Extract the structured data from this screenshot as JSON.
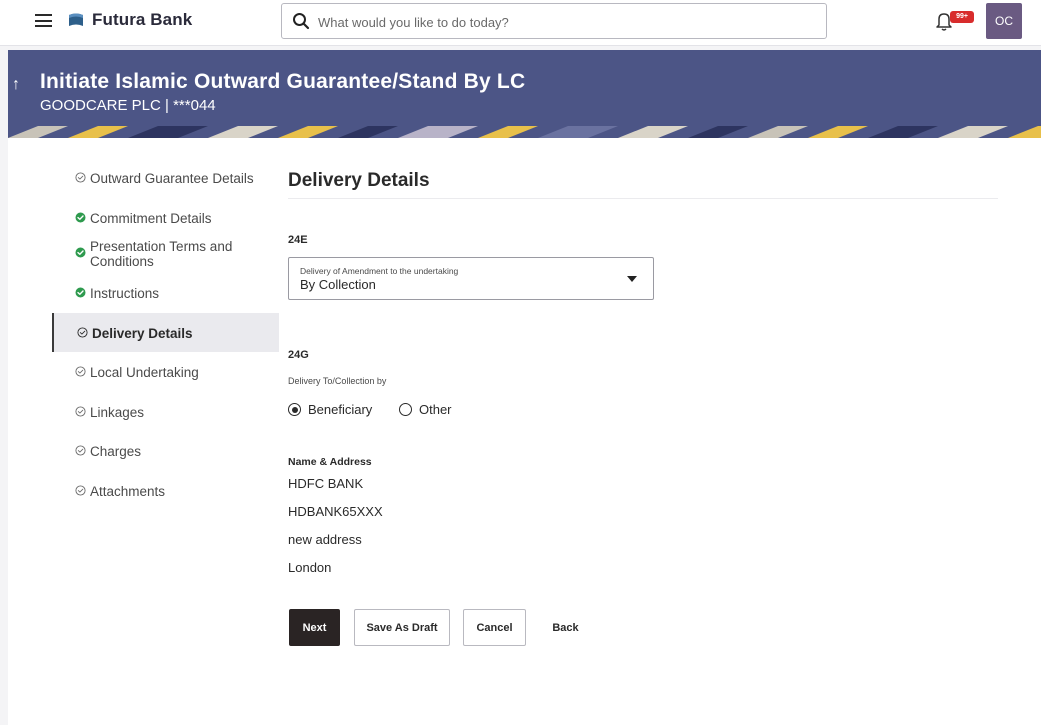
{
  "header": {
    "brand": "Futura Bank",
    "search_placeholder": "What would you like to do today?",
    "notification_badge": "99+",
    "avatar_initials": "OC"
  },
  "banner": {
    "title": "Initiate Islamic Outward Guarantee/Stand By LC",
    "subtitle": "GOODCARE PLC | ***044"
  },
  "steps": [
    {
      "label": "Outward Guarantee Details",
      "status": "pending"
    },
    {
      "label": "Commitment Details",
      "status": "complete"
    },
    {
      "label": "Presentation Terms and Conditions",
      "status": "complete"
    },
    {
      "label": "Instructions",
      "status": "complete"
    },
    {
      "label": "Delivery Details",
      "status": "active"
    },
    {
      "label": "Local Undertaking",
      "status": "pending"
    },
    {
      "label": "Linkages",
      "status": "pending"
    },
    {
      "label": "Charges",
      "status": "pending"
    },
    {
      "label": "Attachments",
      "status": "pending"
    }
  ],
  "form": {
    "heading": "Delivery Details",
    "field_24e_code": "24E",
    "delivery_amendment_label": "Delivery of Amendment to the undertaking",
    "delivery_amendment_value": "By Collection",
    "field_24g_code": "24G",
    "delivery_to_label": "Delivery To/Collection by",
    "radio_beneficiary": "Beneficiary",
    "radio_other": "Other",
    "radio_selected": "Beneficiary",
    "name_address_label": "Name & Address",
    "address_lines": [
      "HDFC BANK",
      "HDBANK65XXX",
      "new address",
      "London"
    ]
  },
  "buttons": {
    "next": "Next",
    "save_draft": "Save As Draft",
    "cancel": "Cancel",
    "back": "Back"
  },
  "colors": {
    "banner_bg": "#4c5586",
    "primary_button": "#2a2424",
    "complete_check": "#2e9a4e",
    "avatar_bg": "#6a5a82",
    "badge_bg": "#d82c2c"
  }
}
